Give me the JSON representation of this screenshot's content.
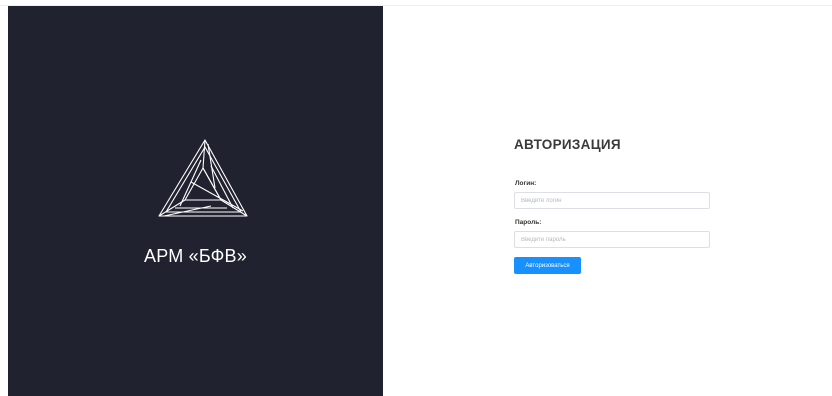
{
  "brand": {
    "logo_icon": "triangle-logo-icon",
    "title": "АРМ «БФВ»",
    "panel_color": "#20232f"
  },
  "auth": {
    "title": "АВТОРИЗАЦИЯ",
    "login": {
      "label": "Логин:",
      "placeholder": "Введите логин",
      "value": ""
    },
    "password": {
      "label": "Пароль:",
      "placeholder": "Введите пароль",
      "value": ""
    },
    "submit_label": "Авторизоваться",
    "accent_color": "#1890ff"
  }
}
